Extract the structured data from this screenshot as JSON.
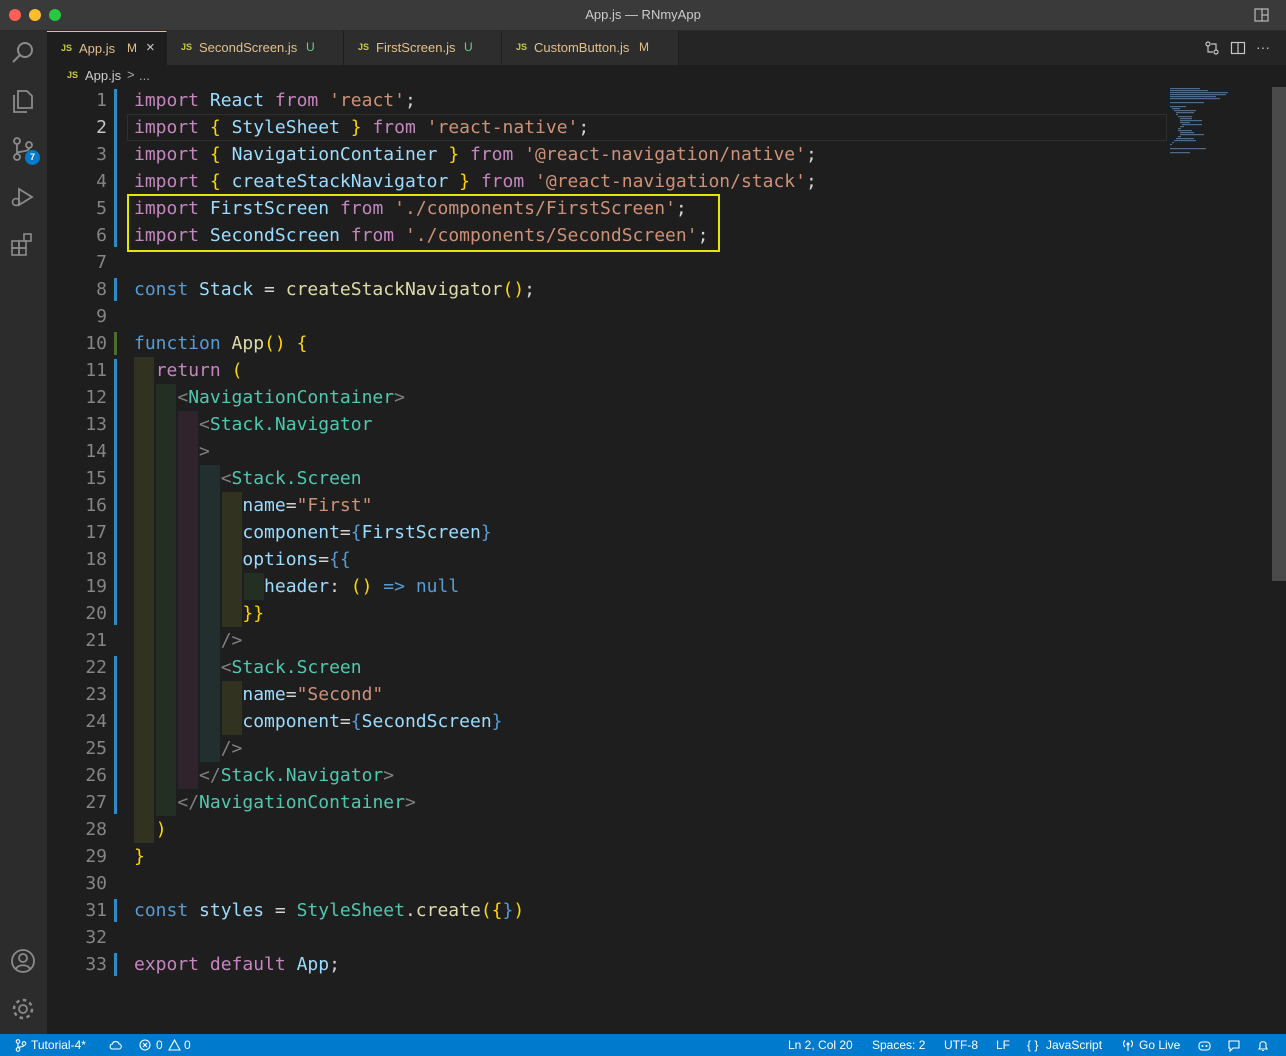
{
  "window": {
    "title": "App.js — RNmyApp"
  },
  "activity_bar": {
    "source_control_badge": "7"
  },
  "tabs": [
    {
      "icon": "JS",
      "name": "App.js",
      "badge": "M",
      "close": "×"
    },
    {
      "icon": "JS",
      "name": "SecondScreen.js",
      "badge": "U"
    },
    {
      "icon": "JS",
      "name": "FirstScreen.js",
      "badge": "U"
    },
    {
      "icon": "JS",
      "name": "CustomButton.js",
      "badge": "M"
    }
  ],
  "tab_actions": {
    "more": "···"
  },
  "breadcrumb": {
    "icon": "JS",
    "file": "App.js",
    "sep": ">",
    "rest": "..."
  },
  "editor": {
    "current_line": 2,
    "lines": [
      "import React from 'react';",
      "import { StyleSheet } from 'react-native';",
      "import { NavigationContainer } from '@react-navigation/native';",
      "import { createStackNavigator } from '@react-navigation/stack';",
      "import FirstScreen from './components/FirstScreen';",
      "import SecondScreen from './components/SecondScreen';",
      "",
      "const Stack = createStackNavigator();",
      "",
      "function App() {",
      "  return (",
      "    <NavigationContainer>",
      "      <Stack.Navigator",
      "      >",
      "        <Stack.Screen",
      "          name=\"First\"",
      "          component={FirstScreen}",
      "          options={{",
      "            header: () => null",
      "          }}",
      "        />",
      "        <Stack.Screen",
      "          name=\"Second\"",
      "          component={SecondScreen}",
      "        />",
      "      </Stack.Navigator>",
      "    </NavigationContainer>",
      "  )",
      "}",
      "",
      "const styles = StyleSheet.create({})",
      "",
      "export default App;"
    ]
  },
  "status_bar": {
    "branch": "Tutorial-4*",
    "errors": "0",
    "warnings": "0",
    "position": "Ln 2, Col 20",
    "spaces": "Spaces: 2",
    "encoding": "UTF-8",
    "eol": "LF",
    "language_brackets": "{ }",
    "language": "JavaScript",
    "go_live": "Go Live"
  },
  "colors": {
    "status_bar": "#007acc",
    "highlight_box": "#e5e500",
    "tab_modified": "#e2c08d"
  }
}
